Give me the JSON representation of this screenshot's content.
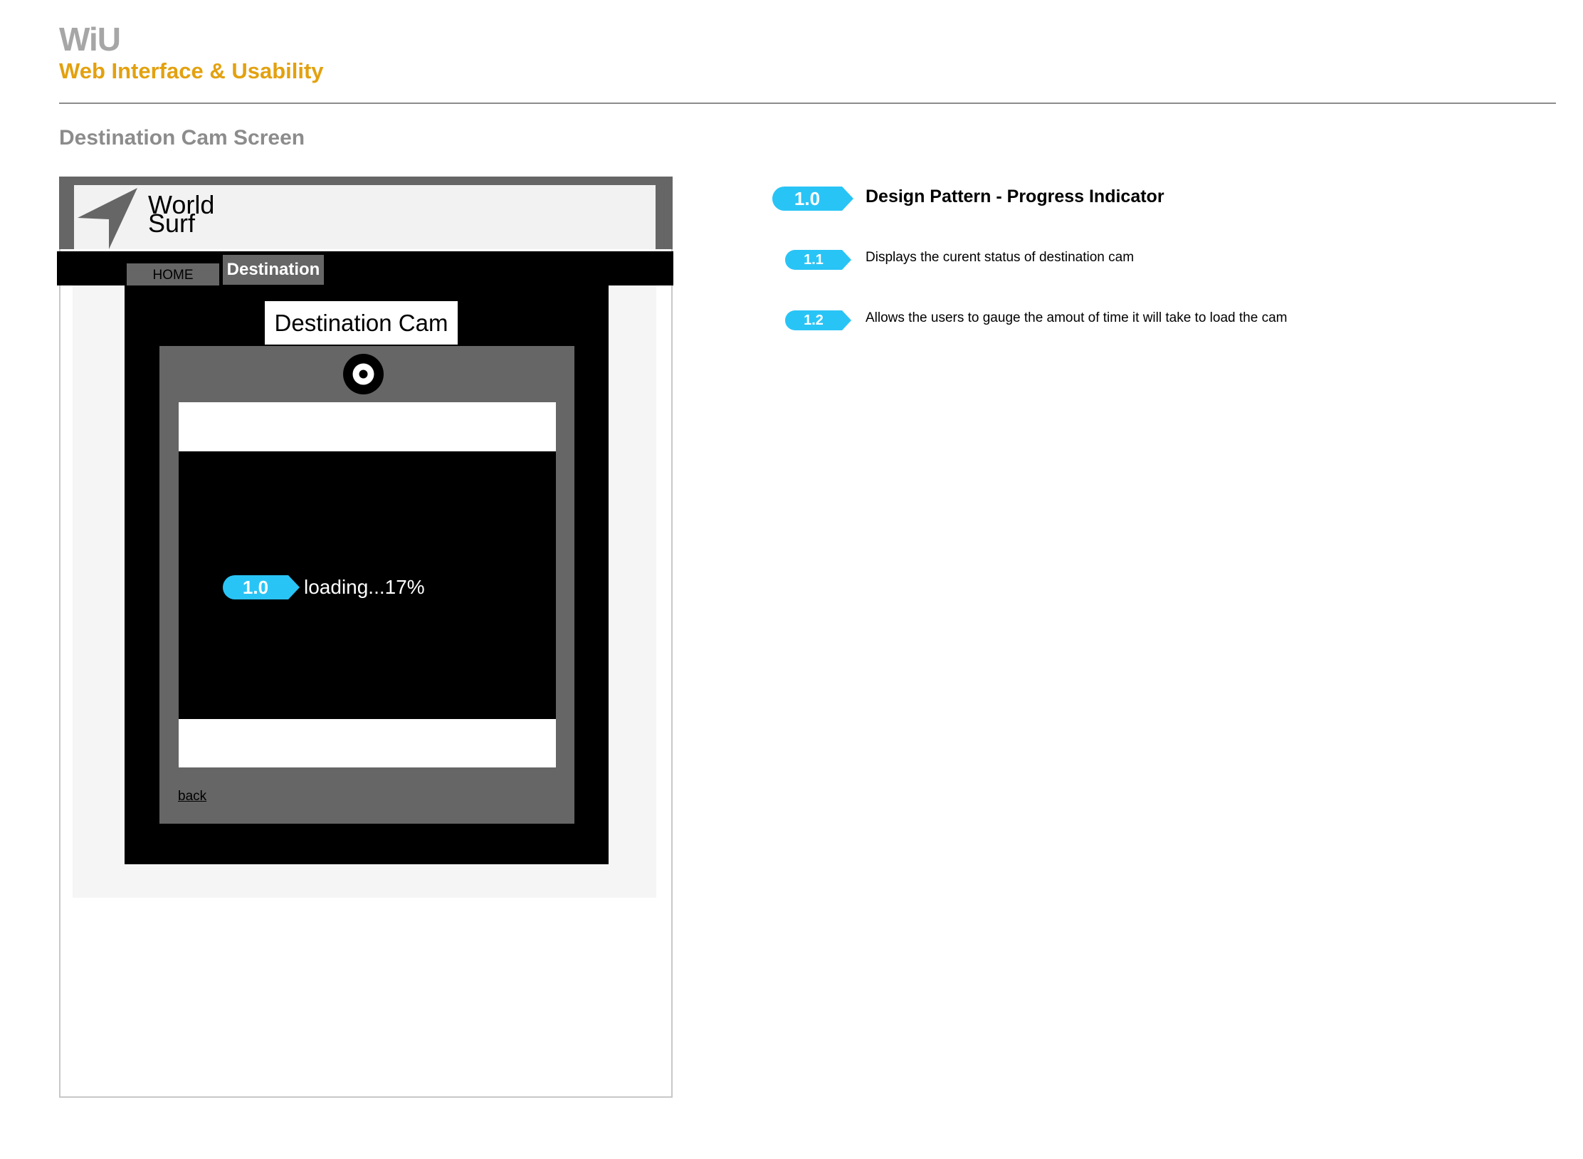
{
  "header": {
    "brand": "WiU",
    "subtitle": "Web Interface & Usability",
    "screen_heading": "Destination Cam Screen"
  },
  "wireframe": {
    "logo_line1": "World",
    "logo_line2": "Surf",
    "nav": {
      "home": "HOME",
      "destination": "Destination"
    },
    "cam_title": "Destination Cam",
    "loading_label": "loading...17%",
    "loading_progress_percent": 17,
    "back_label": "back",
    "icons": {
      "logo": "paper-plane-arrow-icon",
      "status": "target-icon"
    }
  },
  "annotations": {
    "inline_badge": "1.0",
    "items": [
      {
        "id": "1.0",
        "text": "Design Pattern - Progress Indicator"
      },
      {
        "id": "1.1",
        "text": "Displays the curent status of destination cam"
      },
      {
        "id": "1.2",
        "text": "Allows the users to gauge the amout of time it will take to load the cam"
      }
    ]
  },
  "colors": {
    "brand_gray": "#a6a6a6",
    "accent_orange": "#e3a10f",
    "badge_blue": "#29c4f6",
    "frame_gray": "#666666"
  }
}
